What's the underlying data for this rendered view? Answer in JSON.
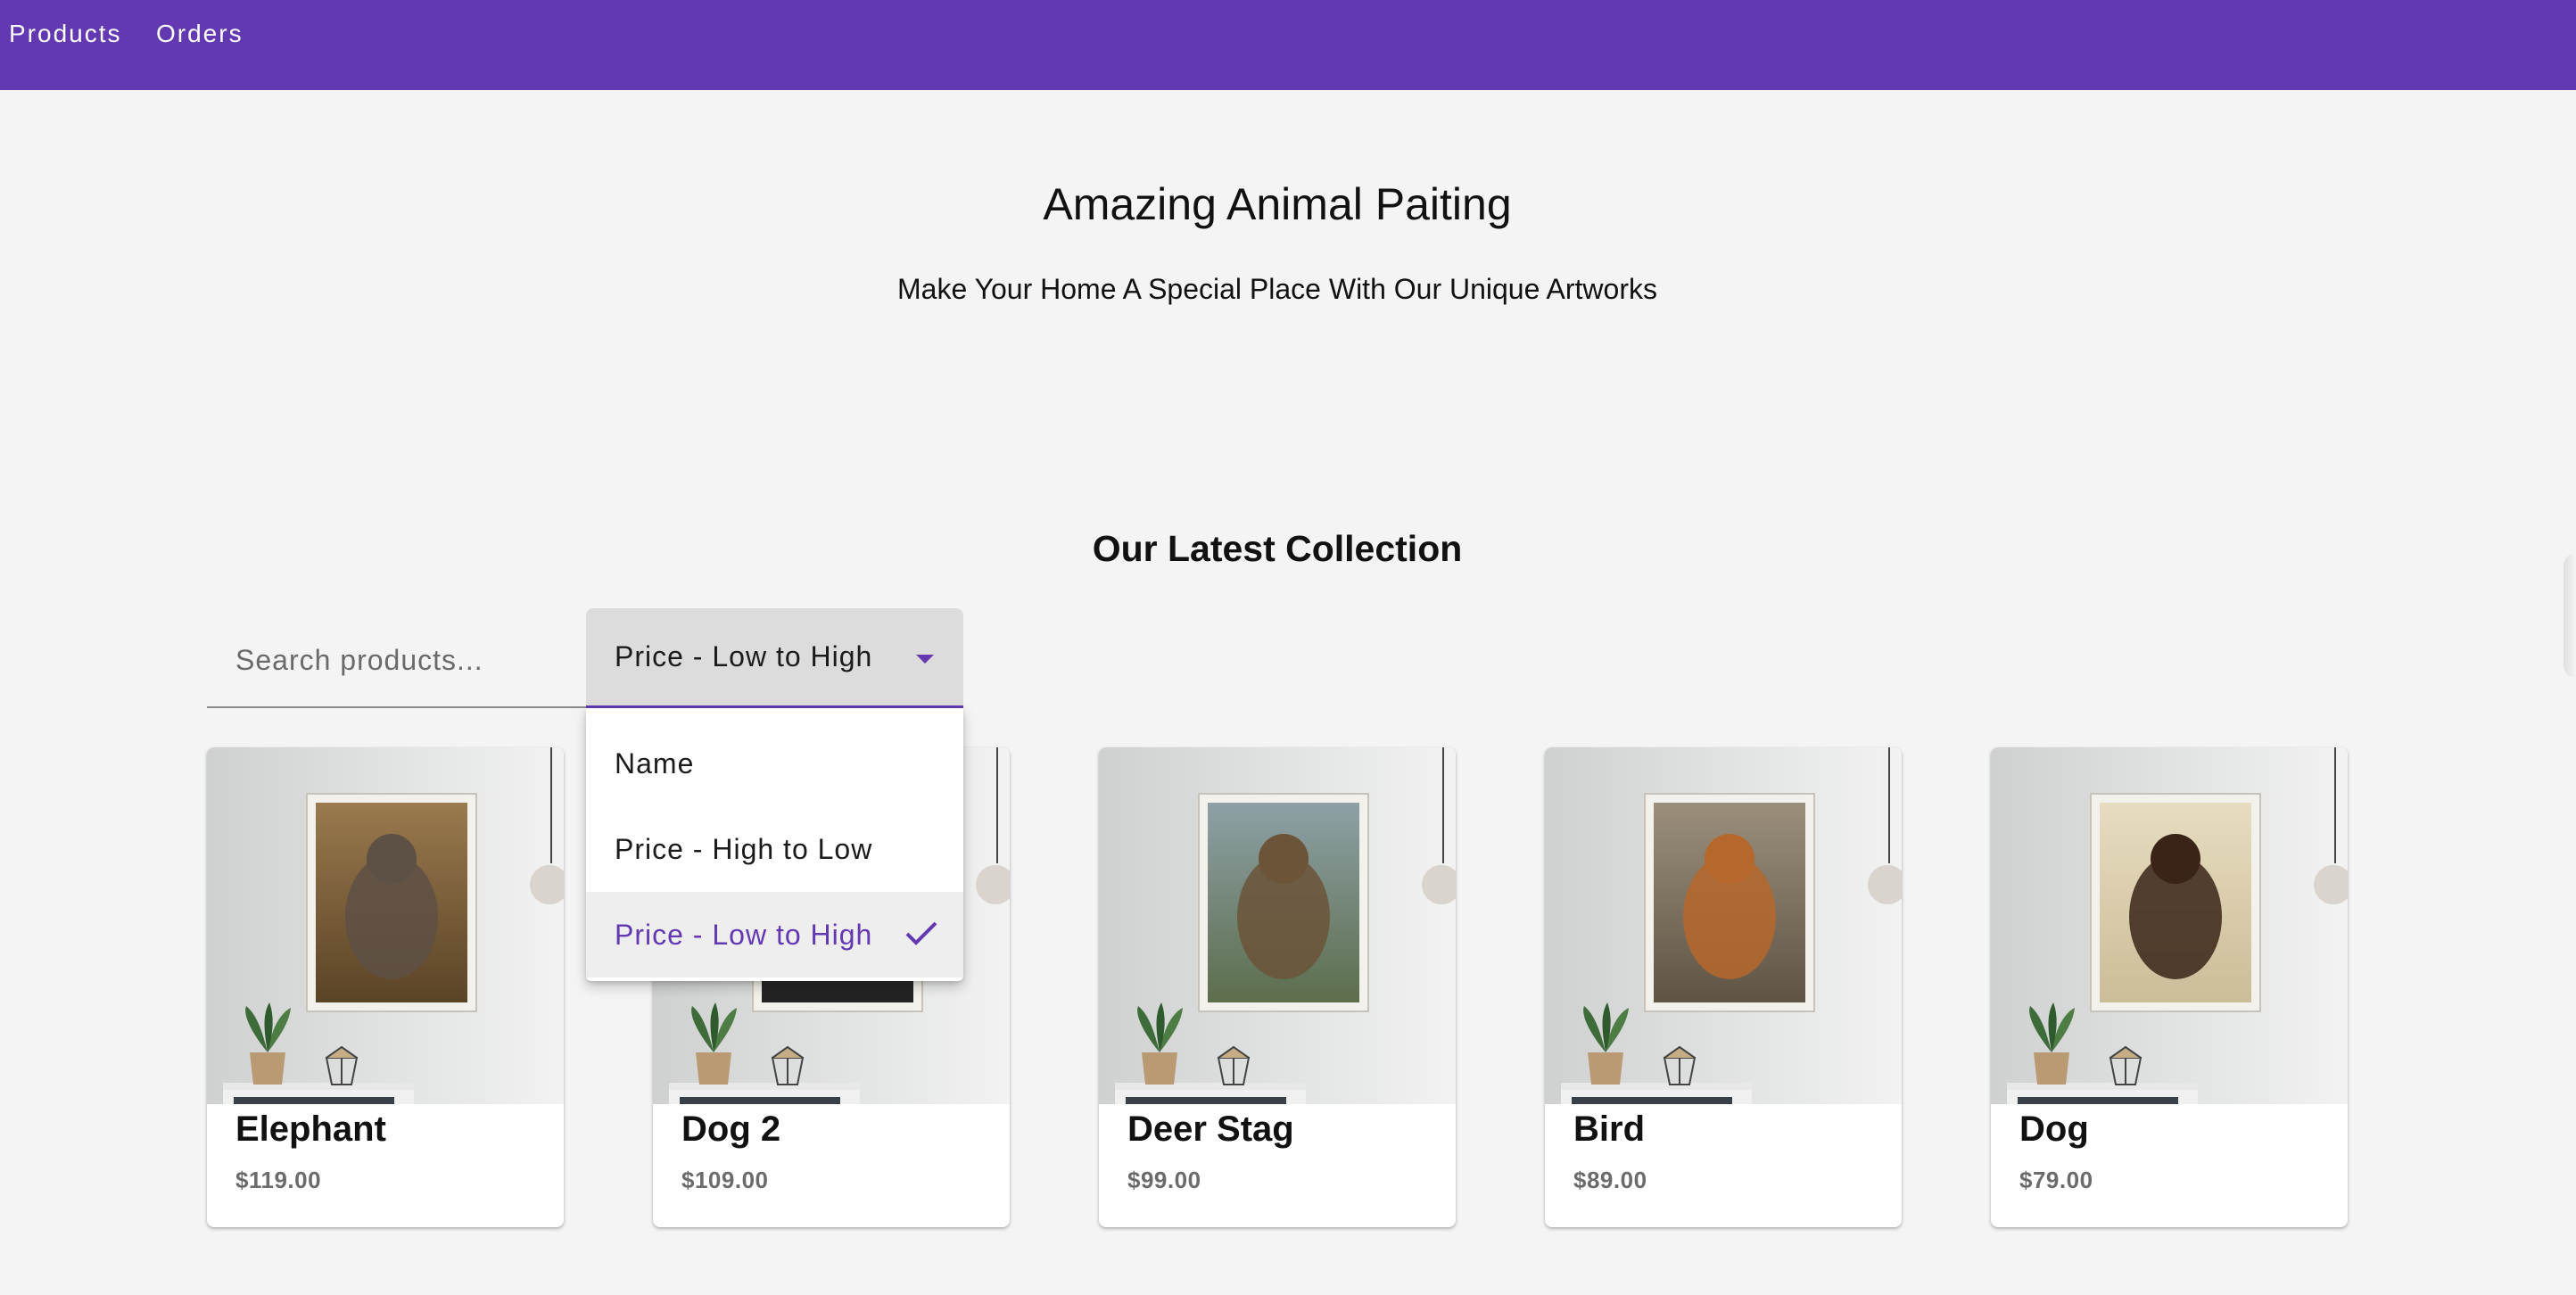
{
  "nav": {
    "products_label": "Products",
    "orders_label": "Orders"
  },
  "hero": {
    "title": "Amazing Animal Paiting",
    "subtitle": "Make Your Home A Special Place With Our Unique Artworks"
  },
  "collection": {
    "title": "Our Latest Collection"
  },
  "search": {
    "placeholder": "Search products..."
  },
  "sort": {
    "selected": "Price - Low to High",
    "options": [
      {
        "label": "Name",
        "selected": false
      },
      {
        "label": "Price - High to Low",
        "selected": false
      },
      {
        "label": "Price - Low to High",
        "selected": true
      }
    ]
  },
  "products": [
    {
      "name": "Elephant",
      "price": "$119.00",
      "icon": "elephant-painting"
    },
    {
      "name": "Dog 2",
      "price": "$109.00",
      "icon": "dog-painting"
    },
    {
      "name": "Deer Stag",
      "price": "$99.00",
      "icon": "deer-stag-painting"
    },
    {
      "name": "Bird",
      "price": "$89.00",
      "icon": "bird-painting"
    },
    {
      "name": "Dog",
      "price": "$79.00",
      "icon": "dachshund-painting"
    }
  ],
  "colors": {
    "brand": "#6239b1",
    "background": "#f4f4f4",
    "card": "#ffffff",
    "select_fill": "#dcdcdc"
  }
}
